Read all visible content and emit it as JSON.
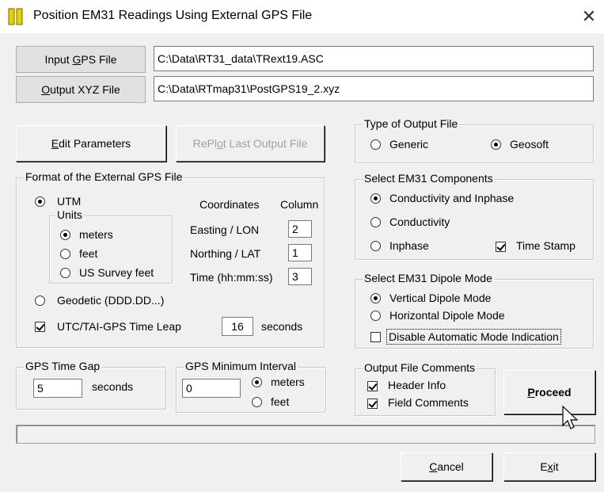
{
  "window": {
    "title": "Position EM31 Readings Using External GPS File",
    "close_glyph": "✕"
  },
  "files": {
    "input_button": {
      "pre": "Input ",
      "key": "G",
      "post": "PS File"
    },
    "input_path": "C:\\Data\\RT31_data\\TRext19.ASC",
    "output_button": {
      "pre": "",
      "key": "O",
      "post": "utput XYZ File"
    },
    "output_path": "C:\\Data\\RTmap31\\PostGPS19_2.xyz"
  },
  "edit_params_button": {
    "pre": "",
    "key": "E",
    "post": "dit Parameters"
  },
  "replot_button": {
    "pre": "RePl",
    "key": "o",
    "post": "t Last Output File"
  },
  "format_group": {
    "legend": "Format of the External GPS File",
    "utm_label": "UTM",
    "units_legend": "Units",
    "units": [
      "meters",
      "feet",
      "US Survey feet"
    ],
    "selected_unit": "meters",
    "coordinates_header": "Coordinates",
    "column_header": "Column",
    "rows": [
      {
        "label": "Easting / LON",
        "column": "2"
      },
      {
        "label": "Northing / LAT",
        "column": "1"
      },
      {
        "label": "Time (hh:mm:ss)",
        "column": "3"
      }
    ],
    "geodetic_label": "Geodetic (DDD.DD...)",
    "coordinate_system": "UTM",
    "leap_label": "UTC/TAI-GPS Time Leap",
    "leap_checked": true,
    "leap_value": "16",
    "leap_units": "seconds"
  },
  "output_type": {
    "legend": "Type of Output File",
    "options": [
      "Generic",
      "Geosoft"
    ],
    "selected": "Geosoft"
  },
  "components": {
    "legend": "Select EM31 Components",
    "options": [
      "Conductivity and Inphase",
      "Conductivity",
      "Inphase"
    ],
    "selected": "Conductivity and Inphase",
    "timestamp_label": "Time Stamp",
    "timestamp_checked": true
  },
  "dipole": {
    "legend": "Select EM31 Dipole Mode",
    "options": [
      "Vertical Dipole Mode",
      "Horizontal Dipole Mode"
    ],
    "selected": "Vertical Dipole Mode",
    "disable_auto_label": "Disable Automatic Mode Indication",
    "disable_auto_checked": false
  },
  "time_gap": {
    "legend": "GPS Time Gap",
    "value": "5",
    "units": "seconds"
  },
  "min_interval": {
    "legend": "GPS Minimum Interval",
    "value": "0",
    "options": [
      "meters",
      "feet"
    ],
    "selected": "meters"
  },
  "comments": {
    "legend": "Output File Comments",
    "header_label": "Header Info",
    "header_checked": true,
    "field_label": "Field Comments",
    "field_checked": true
  },
  "proceed_button": {
    "pre": "",
    "key": "P",
    "post": "roceed"
  },
  "cancel_button": {
    "pre": "",
    "key": "C",
    "post": "ancel"
  },
  "exit_button": {
    "pre": "E",
    "key": "x",
    "post": "it"
  },
  "progress": {
    "value": 0
  }
}
